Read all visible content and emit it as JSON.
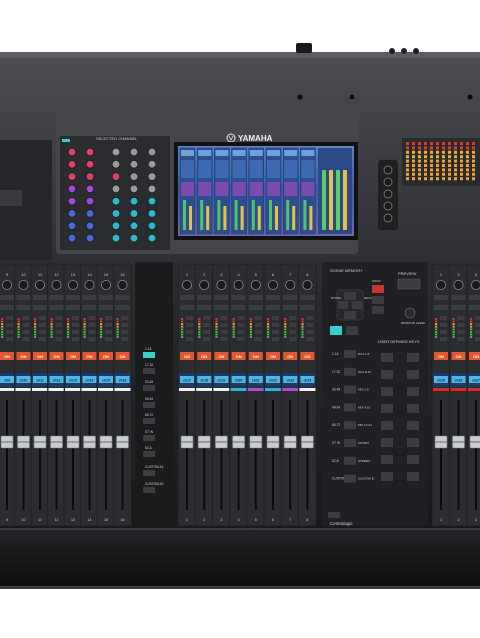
{
  "brand": {
    "name": "YAMAHA",
    "logo_icon": "yamaha-tuning-fork-logo"
  },
  "centralogic": {
    "label": "Centralogic"
  },
  "selected_channel": {
    "label": "SELECTED CHANNEL"
  },
  "scene_memory": {
    "label": "SCENE MEMORY",
    "preview_label": "PREVIEW",
    "undo_label": "UNDO",
    "store_label": "STORE",
    "recall_label": "RECALL"
  },
  "user_defined_keys": {
    "label": "USER DEFINED KEYS"
  },
  "monitor": {
    "label": "MONITOR LEVEL"
  },
  "left_bay": {
    "channel_numbers": [
      "9",
      "10",
      "11",
      "12",
      "13",
      "14",
      "15",
      "16"
    ],
    "name_chips": [
      "ch9",
      "ch10",
      "ch11",
      "ch12",
      "ch13",
      "ch14",
      "ch15",
      "ch16"
    ],
    "on_label": "ON",
    "strip_colors": [
      "#f2f2f2",
      "#f2f2f2",
      "#f2f2f2",
      "#f2f2f2",
      "#f2f2f2",
      "#f2f2f2",
      "#f2f2f2",
      "#f2f2f2"
    ],
    "chip_colors": [
      "#4fb5e8",
      "#4fb5e8",
      "#4fb5e8",
      "#4fb5e8",
      "#4fb5e8",
      "#4fb5e8",
      "#4fb5e8",
      "#4fb5e8"
    ]
  },
  "center_bay": {
    "channel_numbers": [
      "1",
      "2",
      "3",
      "4",
      "5",
      "6",
      "7",
      "8"
    ],
    "name_chips": [
      "ch17",
      "ch18",
      "ch19",
      "ch20",
      "ch21",
      "ch22",
      "ch23",
      "ch24"
    ],
    "on_label": "ON",
    "strip_colors": [
      "#f2f2f2",
      "#f2f2f2",
      "#f2f2f2",
      "#2fb3d8",
      "#b04ad3",
      "#2fb3d8",
      "#b04ad3",
      "#f2f2f2"
    ],
    "chip_colors": [
      "#4fb5e8",
      "#4fb5e8",
      "#4fb5e8",
      "#4fb5e8",
      "#4fb5e8",
      "#4fb5e8",
      "#4fb5e8",
      "#4fb5e8"
    ]
  },
  "right_bay": {
    "channel_numbers": [
      "1",
      "2",
      "3"
    ],
    "name_chips": [
      "ch25",
      "ch26",
      "ch27"
    ],
    "on_label": "ON",
    "strip_colors": [
      "#e02a2a",
      "#e02a2a",
      "#e02a2a"
    ],
    "chip_colors": [
      "#4fb5e8",
      "#4fb5e8",
      "#4fb5e8"
    ]
  },
  "bank_select": {
    "labels": [
      "1-16",
      "17-32",
      "33-48",
      "49-64",
      "65-72",
      "ST IN",
      "DCA",
      "CUSTOM A1",
      "CUSTOM A2"
    ]
  },
  "layer_keys": {
    "labels": [
      "1-16",
      "17-32",
      "33-48",
      "49-64",
      "65-72",
      "ST IN",
      "DCA",
      "CUSTOM A1",
      "CUSTOM A2"
    ],
    "right_labels": [
      "DCA 1-8",
      "DCA 9-16",
      "MIX 1-8",
      "MIX 9-16",
      "MIX 17-24",
      "MATRIX",
      "STEREO",
      "CUSTOM B"
    ]
  },
  "colors": {
    "chassis": "#2b2d31",
    "panel": "#1d1f22",
    "top_panel": "#3a3c40",
    "on_button": "#e3562f",
    "screen": "#2f6ea8"
  }
}
